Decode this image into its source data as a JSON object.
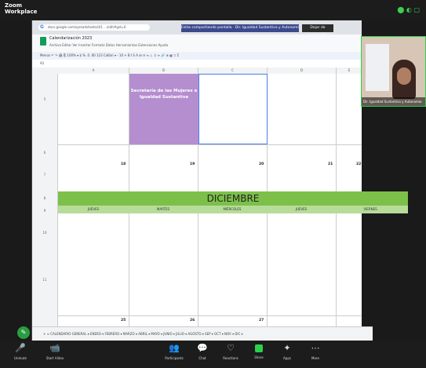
{
  "zoom": {
    "title_line1": "Zoom",
    "title_line2": "Workplace",
    "header_icons": "⬤ ◐ ▢",
    "controls": [
      {
        "label": "Unmute",
        "icon": "🎤"
      },
      {
        "label": "Start Video",
        "icon": "📹"
      },
      {
        "label": "Participants",
        "icon": "👥"
      },
      {
        "label": "Chat",
        "icon": "💬"
      },
      {
        "label": "Reactions",
        "icon": "♡"
      },
      {
        "label": "Share",
        "icon": "▲"
      },
      {
        "label": "Apps",
        "icon": "✦"
      },
      {
        "label": "More",
        "icon": "⋯"
      }
    ]
  },
  "browser": {
    "url": "docs.google.com/spreadsheets/d/1 .../edit#gid=0",
    "share_banner": "Estás compartiendo pantalla · Dir. Igualdad Sustantiva y Autonomía",
    "stop_button": "Dejar de compartir"
  },
  "doc": {
    "title": "Calendarización 2023",
    "menu": "Archivo  Editar  Ver  Insertar  Formato  Datos  Herramientas  Extensiones  Ayuda",
    "toolbar": "Menús   ↶  ↷  🖨  ⎘  100%  ▾   $  %  .0  .00  123   Calibri  ▾   -  10  +   B  I  S  A   ⊞  ☷   ≡  ⊥  ↕  ↔   🔗  ⊕  ▦  ▽  Σ",
    "cell_ref": "A1",
    "col_headers": [
      "A",
      "B",
      "C",
      "D",
      "E"
    ],
    "purple_cell": "Secretaría de las Mujeres e Igualdad Sustantiva",
    "month": "DICIEMBRE",
    "days": [
      "JUEVES",
      "MARTES",
      "MIÉRCOLES",
      "JUEVES",
      "VIERNES"
    ],
    "week1": [
      "18",
      "19",
      "20",
      "21",
      "22"
    ],
    "week2": [
      "25",
      "26",
      "27",
      "",
      ""
    ],
    "tabs": "+   ≡   CALENDARIO GENERAL ▾   ENERO ▾   FEBRERO ▾   MARZO ▾   ABRIL ▾   MAYO ▾   JUNIO ▾   JULIO ▾   AGOSTO ▾   SEP ▾   OCT ▾   NOV ▾   DIC ▾"
  },
  "webcam": {
    "label": "Dir. Igualdad Sustantiva y Autonomía"
  }
}
